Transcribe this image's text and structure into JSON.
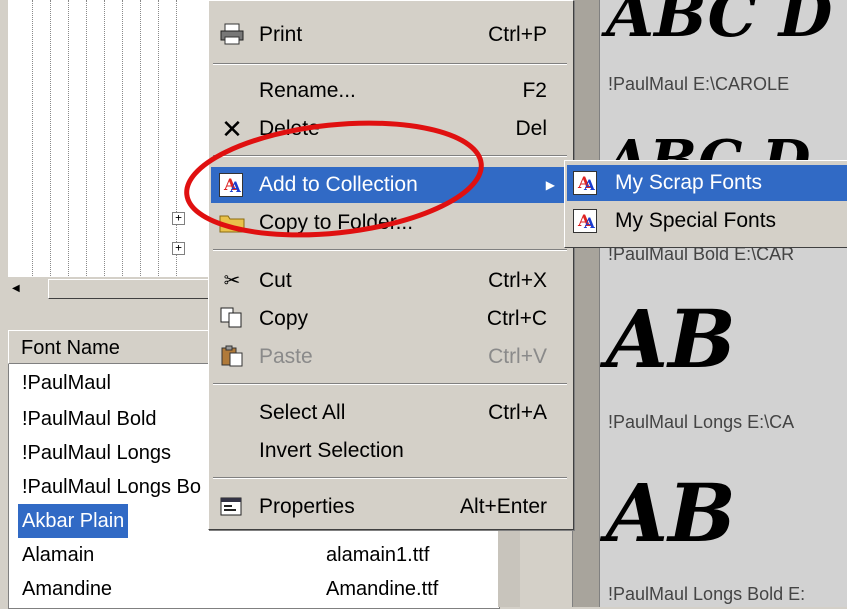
{
  "menu": {
    "items": [
      {
        "label": "Print",
        "shortcut": "Ctrl+P",
        "icon": "printer-icon",
        "state": "normal"
      },
      {
        "label": "Rename...",
        "shortcut": "F2",
        "icon": "",
        "state": "normal"
      },
      {
        "label": "Delete",
        "shortcut": "Del",
        "icon": "delete-x-icon",
        "state": "normal"
      },
      {
        "label": "Add to Collection",
        "shortcut": "",
        "icon": "collection-icon",
        "state": "highlighted"
      },
      {
        "label": "Copy to Folder...",
        "shortcut": "",
        "icon": "folder-icon",
        "state": "normal"
      },
      {
        "label": "Cut",
        "shortcut": "Ctrl+X",
        "icon": "scissors-icon",
        "state": "normal"
      },
      {
        "label": "Copy",
        "shortcut": "Ctrl+C",
        "icon": "copy-icon",
        "state": "normal"
      },
      {
        "label": "Paste",
        "shortcut": "Ctrl+V",
        "icon": "paste-icon",
        "state": "disabled"
      },
      {
        "label": "Select All",
        "shortcut": "Ctrl+A",
        "icon": "",
        "state": "normal"
      },
      {
        "label": "Invert Selection",
        "shortcut": "",
        "icon": "",
        "state": "normal"
      },
      {
        "label": "Properties",
        "shortcut": "Alt+Enter",
        "icon": "properties-icon",
        "state": "normal"
      }
    ]
  },
  "submenu": {
    "items": [
      {
        "label": "My Scrap Fonts",
        "state": "highlighted"
      },
      {
        "label": "My Special Fonts",
        "state": "normal"
      }
    ]
  },
  "font_list": {
    "header": "Font Name",
    "rows": [
      {
        "name": "!PaulMaul",
        "file": ""
      },
      {
        "name": "!PaulMaul Bold",
        "file": ""
      },
      {
        "name": "!PaulMaul Longs",
        "file": ""
      },
      {
        "name": "!PaulMaul Longs Bo",
        "file": ""
      },
      {
        "name": "Akbar  Plain",
        "file": "",
        "selected": true
      },
      {
        "name": "Alamain",
        "file": "alamain1.ttf"
      },
      {
        "name": "Amandine",
        "file": "Amandine.ttf"
      }
    ]
  },
  "preview": {
    "samples": [
      {
        "glyphs": "ABC D",
        "label": "!PaulMaul   E:\\CAROLE"
      },
      {
        "glyphs": "ABC D",
        "label": "!PaulMaul Bold   E:\\CAR"
      },
      {
        "glyphs": "AB",
        "label": "!PaulMaul Longs   E:\\CA"
      },
      {
        "glyphs": "AB",
        "label": "!PaulMaul Longs Bold   E:"
      }
    ]
  },
  "tree": {
    "expanders": [
      "+",
      "+"
    ]
  },
  "colors": {
    "highlight": "#316ac5",
    "annotation": "#e01010",
    "menu_bg": "#d4d0c8"
  }
}
